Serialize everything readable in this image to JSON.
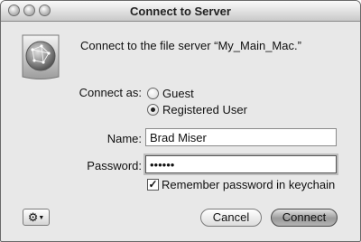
{
  "window": {
    "title": "Connect to Server"
  },
  "headline": "Connect to the file server “My_Main_Mac.”",
  "connect_as": {
    "label": "Connect as:",
    "options": [
      {
        "label": "Guest",
        "selected": false
      },
      {
        "label": "Registered User",
        "selected": true
      }
    ]
  },
  "fields": {
    "name_label": "Name:",
    "name_value": "Brad Miser",
    "password_label": "Password:",
    "password_value": "••••••"
  },
  "remember": {
    "label": "Remember password in keychain",
    "checked": true
  },
  "buttons": {
    "cancel": "Cancel",
    "connect": "Connect"
  },
  "icons": {
    "action": "gear-icon",
    "server": "network-globe-icon"
  }
}
